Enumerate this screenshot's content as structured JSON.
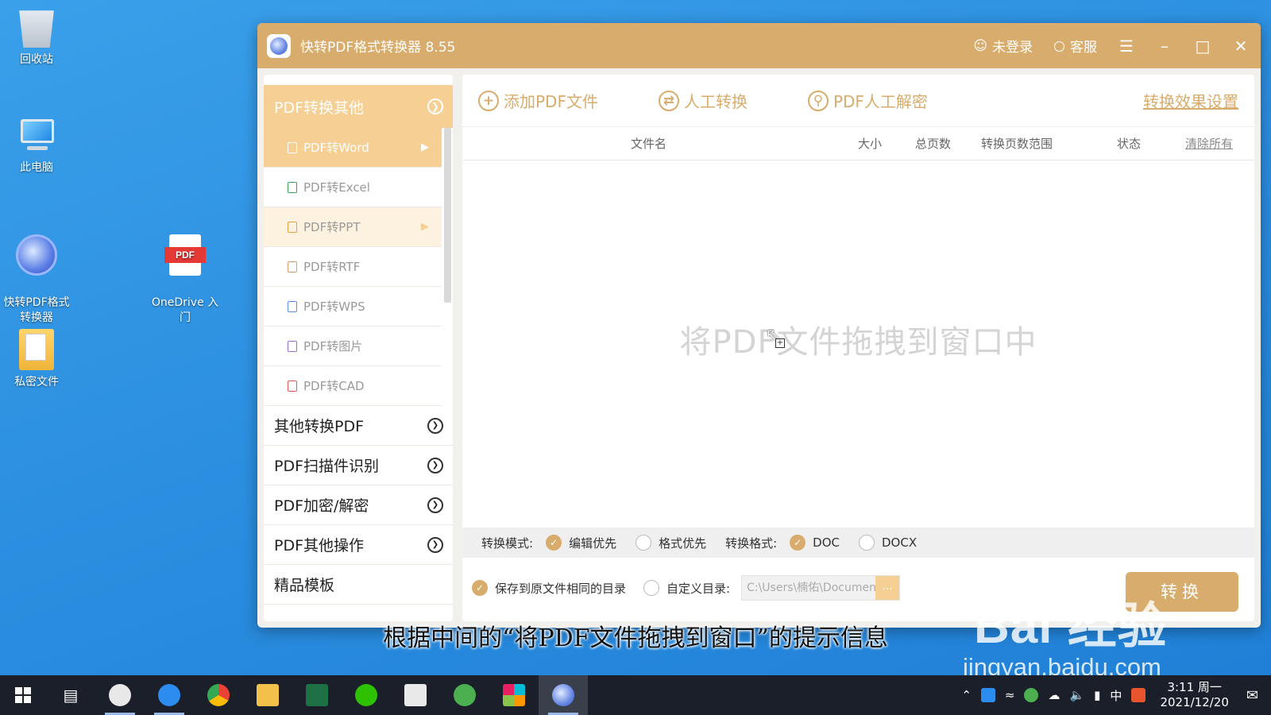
{
  "desktop": {
    "icons": [
      {
        "label": "回收站"
      },
      {
        "label": "此电脑"
      },
      {
        "label": "快转PDF格式\n转换器"
      },
      {
        "label": "OneDrive 入\n门"
      },
      {
        "label": "私密文件"
      }
    ],
    "pdf_icon_text": "PDF"
  },
  "window": {
    "title": "快转PDF格式转换器 8.55",
    "login": "未登录",
    "service": "客服"
  },
  "sidebar": {
    "header": "PDF转换其他",
    "subitems": [
      {
        "label": "PDF转Word",
        "state": "active"
      },
      {
        "label": "PDF转Excel",
        "state": "normal"
      },
      {
        "label": "PDF转PPT",
        "state": "hover"
      },
      {
        "label": "PDF转RTF",
        "state": "normal"
      },
      {
        "label": "PDF转WPS",
        "state": "normal"
      },
      {
        "label": "PDF转图片",
        "state": "normal"
      },
      {
        "label": "PDF转CAD",
        "state": "normal"
      }
    ],
    "categories": [
      {
        "label": "其他转换PDF"
      },
      {
        "label": "PDF扫描件识别"
      },
      {
        "label": "PDF加密/解密"
      },
      {
        "label": "PDF其他操作"
      },
      {
        "label": "精品模板"
      }
    ]
  },
  "toolbar": {
    "add_pdf": "添加PDF文件",
    "manual_convert": "人工转换",
    "manual_decrypt": "PDF人工解密",
    "settings": "转换效果设置"
  },
  "table": {
    "headers": {
      "filename": "文件名",
      "size": "大小",
      "pages": "总页数",
      "range": "转换页数范围",
      "status": "状态",
      "clear": "清除所有"
    }
  },
  "drop_hint": "将PDF文件拖拽到窗口中",
  "options": {
    "mode_label": "转换模式:",
    "mode_edit": "编辑优先",
    "mode_format": "格式优先",
    "format_label": "转换格式:",
    "fmt_doc": "DOC",
    "fmt_docx": "DOCX",
    "save_same": "保存到原文件相同的目录",
    "custom_dir": "自定义目录:",
    "path": "C:\\Users\\楠佑\\Document...",
    "browse": "...",
    "convert": "转换"
  },
  "subtitle": "根据中间的“将PDF文件拖拽到窗口”的提示信息",
  "watermark": {
    "brand": "Bai 经验",
    "url": "jingyan.baidu.com"
  },
  "taskbar": {
    "tray_lang": "中",
    "time": "3:11 周一",
    "date": "2021/12/20"
  },
  "colors": {
    "accent": "#d8ac6c",
    "accent_light": "#f6cf95"
  }
}
